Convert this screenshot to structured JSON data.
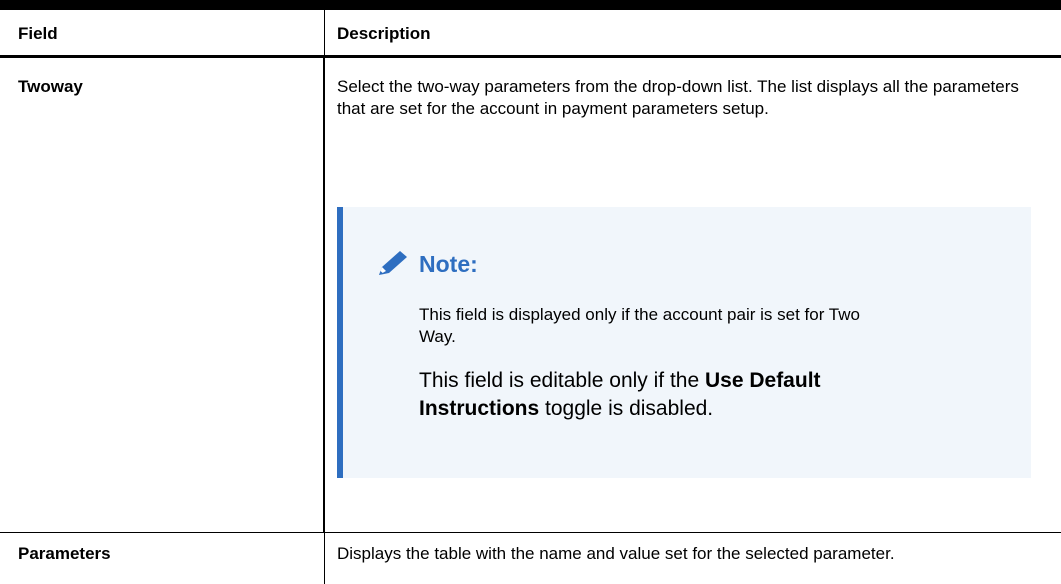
{
  "table": {
    "header": {
      "field": "Field",
      "description": "Description"
    },
    "rows": [
      {
        "field": "Twoway",
        "description": "Select the two-way parameters from the drop-down list. The list displays all the parameters that are set for the account in payment parameters setup.",
        "note": {
          "icon": "pencil-icon",
          "title": "Note:",
          "text1": "This field is displayed only if the account pair is set for Two Way.",
          "text2_prefix": "This field is editable only if the ",
          "text2_bold": "Use Default Instructions",
          "text2_suffix": " toggle is disabled."
        }
      },
      {
        "field": "Parameters",
        "description": "Displays the table with the name and value set for the selected parameter."
      }
    ]
  },
  "colors": {
    "note_accent": "#2e6ec0",
    "note_background": "#f1f6fb"
  }
}
